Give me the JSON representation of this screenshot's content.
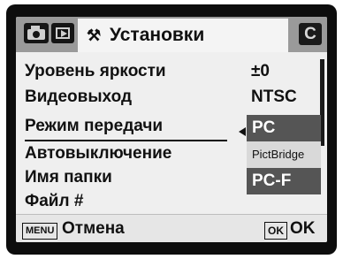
{
  "header": {
    "tabs": [
      {
        "icon": "camera-icon"
      },
      {
        "icon": "playback-icon"
      },
      {
        "icon": "wrench-icon",
        "title": "Установки"
      },
      {
        "label": "C"
      }
    ]
  },
  "menu": {
    "items": [
      {
        "label": "Уровень яркости",
        "value": "±0"
      },
      {
        "label": "Видеовыход",
        "value": "NTSC"
      },
      {
        "label": "Режим передачи",
        "value": ""
      },
      {
        "label": "Автовыключение",
        "value": ""
      },
      {
        "label": "Имя папки",
        "value": ""
      },
      {
        "label": "Файл #",
        "value": ""
      }
    ]
  },
  "dropdown": {
    "options": [
      "PC",
      "PictBridge",
      "PC-F"
    ],
    "selected": "PC"
  },
  "footer": {
    "menu_key": "MENU",
    "cancel_label": "Отмена",
    "ok_key": "OK",
    "ok_label": "OK"
  },
  "colors": {
    "header_bg": "#9a9a9a",
    "screen_bg": "#efefef",
    "selected_bg": "#555555"
  }
}
